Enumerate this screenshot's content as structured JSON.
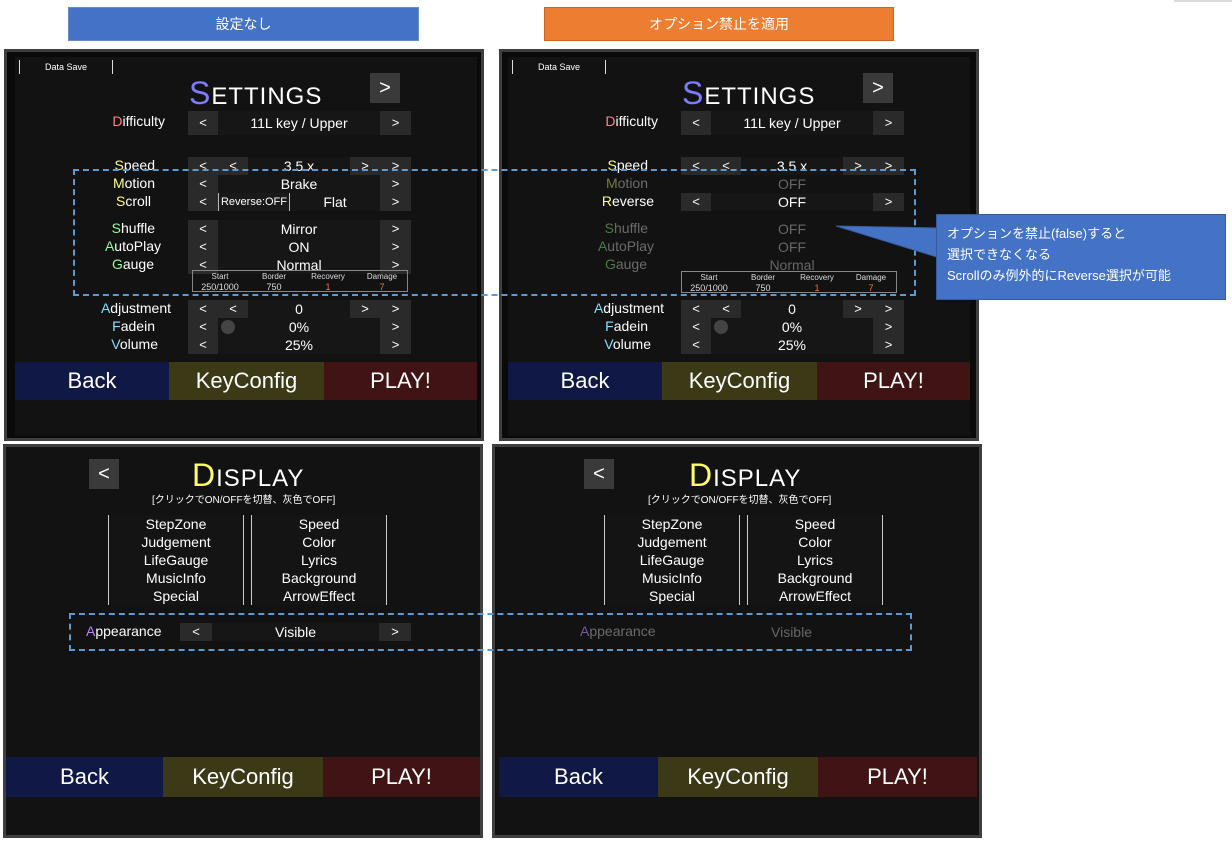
{
  "banners": {
    "left": "設定なし",
    "right": "オプション禁止を適用"
  },
  "callout": {
    "line1": "オプションを禁止(false)すると",
    "line2": "選択できなくなる",
    "line3": "Scrollのみ例外的にReverse選択が可能"
  },
  "settings": {
    "data_save": "Data Save",
    "title_first": "S",
    "title_rest": "ETTINGS",
    "next": ">",
    "prev": "<",
    "difficulty": {
      "first": "D",
      "rest": "ifficulty",
      "value": "11L key / Upper"
    },
    "speed": {
      "first": "S",
      "rest": "peed",
      "value": "3.5 x"
    },
    "motion": {
      "first": "M",
      "rest": "otion",
      "value": "Brake",
      "value_disabled": "OFF"
    },
    "scroll": {
      "first": "S",
      "rest": "croll",
      "reverse": "Reverse:OFF",
      "value": "Flat"
    },
    "reverse": {
      "first": "R",
      "rest": "everse",
      "value": "OFF"
    },
    "shuffle": {
      "first": "S",
      "rest": "huffle",
      "value": "Mirror",
      "value_disabled": "OFF"
    },
    "autoplay": {
      "first": "A",
      "rest": "utoPlay",
      "value": "ON",
      "value_disabled": "OFF"
    },
    "gauge": {
      "first": "G",
      "rest": "auge",
      "value": "Normal",
      "value_disabled": "Normal"
    },
    "gauge_table": {
      "headers": [
        "Start",
        "Border",
        "Recovery",
        "Damage"
      ],
      "values": [
        "250/1000",
        "750",
        "1",
        "7"
      ]
    },
    "adjustment": {
      "first": "A",
      "rest": "djustment",
      "value": "0"
    },
    "fadein": {
      "first": "F",
      "rest": "adein",
      "value": "0%"
    },
    "volume": {
      "first": "V",
      "rest": "olume",
      "value": "25%"
    },
    "bottom": {
      "back": "Back",
      "keyconfig": "KeyConfig",
      "play": "PLAY!"
    }
  },
  "display": {
    "title_first": "D",
    "title_rest": "ISPLAY",
    "prev": "<",
    "subtitle": "[クリックでON/OFFを切替、灰色でOFF]",
    "left_items": [
      "StepZone",
      "Judgement",
      "LifeGauge",
      "MusicInfo",
      "Special"
    ],
    "right_items": [
      "Speed",
      "Color",
      "Lyrics",
      "Background",
      "ArrowEffect"
    ],
    "appearance": {
      "first": "A",
      "rest": "ppearance",
      "value": "Visible"
    },
    "bottom": {
      "back": "Back",
      "keyconfig": "KeyConfig",
      "play": "PLAY!"
    }
  },
  "colors": {
    "difficulty": "#ff8080",
    "speed": "#ffff80",
    "motion": "#ffff80",
    "scroll": "#ffff80",
    "shuffle": "#90ff90",
    "autoplay": "#90ff90",
    "gauge": "#90ff90",
    "adjustment": "#80e0ff",
    "fadein": "#80e0ff",
    "volume": "#80e0ff",
    "appearance": "#c080ff",
    "highlight_dash": "#5b9bd5",
    "callout": "#4472c4"
  }
}
